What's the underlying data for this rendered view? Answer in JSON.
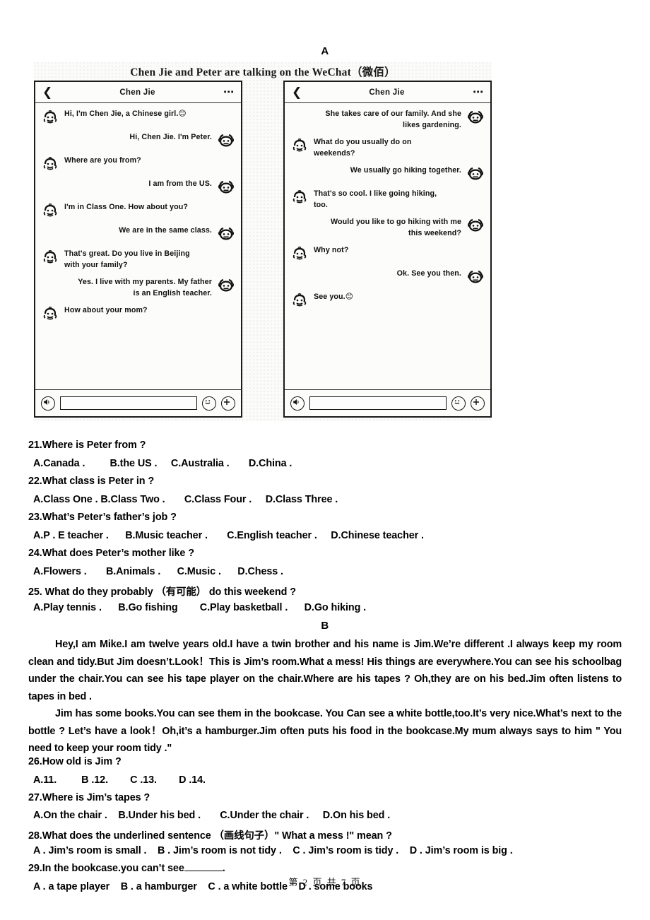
{
  "page": {
    "section_a_label": "A",
    "section_b_label": "B",
    "footer": "第 2 页 共 7 页"
  },
  "reading_a": {
    "caption": "Chen Jie and Peter are talking on the WeChat（微佰）",
    "phones": [
      {
        "id": "left",
        "header": {
          "back_icon": "chevron-left-icon",
          "title": "Chen Jie",
          "menu_icon": "more-dots-icon"
        },
        "messages": [
          {
            "side": "left",
            "sender": "Chen Jie",
            "text": "Hi, I'm Chen Jie, a Chinese girl.😊"
          },
          {
            "side": "right",
            "sender": "Peter",
            "text": "Hi, Chen Jie. I'm Peter."
          },
          {
            "side": "left",
            "sender": "Chen Jie",
            "text": "Where are you from?"
          },
          {
            "side": "right",
            "sender": "Peter",
            "text": "I am from the US."
          },
          {
            "side": "left",
            "sender": "Chen Jie",
            "text": "I'm in Class One. How about you?"
          },
          {
            "side": "right",
            "sender": "Peter",
            "text": "We are in the same class."
          },
          {
            "side": "left",
            "sender": "Chen Jie",
            "text": "That's great. Do you live in Beijing with your family?"
          },
          {
            "side": "right",
            "sender": "Peter",
            "text": "Yes. I live with my parents. My father is an English teacher."
          },
          {
            "side": "left",
            "sender": "Chen Jie",
            "text": "How about your mom?"
          }
        ],
        "footer": {
          "voice_icon": "voice-speaker-icon",
          "input_value": "",
          "input_placeholder": "",
          "emoji_icon": "smiley-emoji-icon",
          "plus_icon": "plus-circle-icon"
        }
      },
      {
        "id": "right",
        "header": {
          "back_icon": "chevron-left-icon",
          "title": "Chen Jie",
          "menu_icon": "more-dots-icon"
        },
        "messages": [
          {
            "side": "right",
            "sender": "Peter",
            "text": "She takes care of our family. And she likes gardening."
          },
          {
            "side": "left",
            "sender": "Chen Jie",
            "text": "What do you usually do on weekends?"
          },
          {
            "side": "right",
            "sender": "Peter",
            "text": "We usually go hiking together."
          },
          {
            "side": "left",
            "sender": "Chen Jie",
            "text": "That's so cool. I like going hiking, too."
          },
          {
            "side": "right",
            "sender": "Peter",
            "text": "Would you like to go hiking with me this weekend?"
          },
          {
            "side": "left",
            "sender": "Chen Jie",
            "text": "Why not?"
          },
          {
            "side": "right",
            "sender": "Peter",
            "text": "Ok. See you then."
          },
          {
            "side": "left",
            "sender": "Chen Jie",
            "text": "See you.😊"
          }
        ],
        "footer": {
          "voice_icon": "voice-speaker-icon",
          "input_value": "",
          "input_placeholder": "",
          "emoji_icon": "smiley-emoji-icon",
          "plus_icon": "plus-circle-icon"
        }
      }
    ],
    "questions": [
      {
        "stem": "21.Where is Peter from ?",
        "options": "A.Canada .         B.the US .     C.Australia .       D.China ."
      },
      {
        "stem": "22.What class is Peter in ?",
        "options": "A.Class One . B.Class Two .       C.Class Four .     D.Class Three ."
      },
      {
        "stem": "23.What’s Peter’s father’s job ?",
        "options": "A.P . E teacher .      B.Music teacher .       C.English teacher .     D.Chinese teacher ."
      },
      {
        "stem": "24.What does Peter’s mother like ?",
        "options": "A.Flowers .       B.Animals .      C.Music .      D.Chess ."
      },
      {
        "stem": "25. What do they probably （有可能） do this weekend ?",
        "options": "A.Play tennis .      B.Go fishing        C.Play basketball .      D.Go hiking ."
      }
    ]
  },
  "reading_b": {
    "paragraphs": [
      "Hey,I am Mike.I am twelve years old.I have a twin brother and his name is Jim.We’re different .I always keep my room clean and tidy.But Jim doesn’t.Look！This is Jim’s room.What a mess! His things are everywhere.You can see his schoolbag under the chair.You can see his tape player on the chair.Where are his tapes ? Oh,they are on his bed.Jim often listens to tapes in bed .",
      "Jim has some books.You can see them in the bookcase. You Can see a white bottle,too.It’s very nice.What’s next to the bottle ? Let’s have a look！Oh,it’s a hamburger.Jim often puts his food in the bookcase.My mum always says to him \" You need to keep your room tidy .\""
    ],
    "questions": [
      {
        "stem": "26.How old is Jim ?",
        "options": "A.11.         B .12.        C .13.        D .14."
      },
      {
        "stem": "27.Where is Jim’s tapes ?",
        "options": "A.On the chair .    B.Under his bed .       C.Under the chair .     D.On his bed ."
      },
      {
        "stem": "28.What does the underlined sentence （画线句子）\" What a mess !\" mean ?",
        "options": "A . Jim’s room is small .    B . Jim’s room is not tidy .    C . Jim’s room is tidy .    D . Jim’s room is big ."
      },
      {
        "stem_pre": "29.In the bookcase.you can’t see",
        "stem_post": ".",
        "options": "A . a tape player    B . a hamburger    C . a white bottle    D . some books"
      }
    ]
  }
}
